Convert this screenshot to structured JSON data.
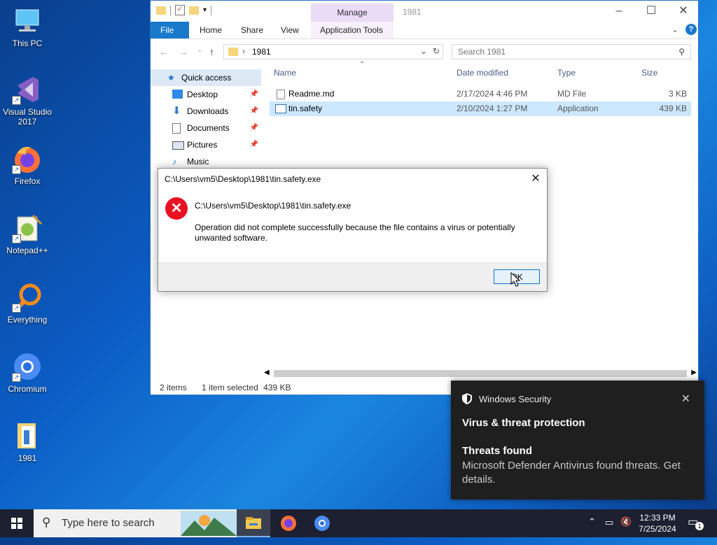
{
  "desktop": {
    "icons": [
      {
        "label": "This PC"
      },
      {
        "label": "Visual Studio 2017"
      },
      {
        "label": "Firefox"
      },
      {
        "label": "Notepad++"
      },
      {
        "label": "Everything"
      },
      {
        "label": "Chromium"
      },
      {
        "label": "1981"
      }
    ]
  },
  "explorer": {
    "title": "1981",
    "manage_label": "Manage",
    "ribbon_tabs": [
      "File",
      "Home",
      "Share",
      "View",
      "Application Tools"
    ],
    "address": "1981",
    "search_placeholder": "Search 1981",
    "nav": {
      "quick_access": "Quick access",
      "items": [
        {
          "label": "Desktop"
        },
        {
          "label": "Downloads"
        },
        {
          "label": "Documents"
        },
        {
          "label": "Pictures"
        },
        {
          "label": "Music"
        }
      ]
    },
    "columns": [
      "Name",
      "Date modified",
      "Type",
      "Size"
    ],
    "files": [
      {
        "name": "Readme.md",
        "date": "2/17/2024 4:46 PM",
        "type": "MD File",
        "size": "3 KB"
      },
      {
        "name": "tin.safety",
        "date": "2/10/2024 1:27 PM",
        "type": "Application",
        "size": "439 KB"
      }
    ],
    "status": {
      "count": "2 items",
      "selected": "1 item selected",
      "size": "439 KB"
    }
  },
  "dialog": {
    "title": "C:\\Users\\vm5\\Desktop\\1981\\tin.safety.exe",
    "heading": "C:\\Users\\vm5\\Desktop\\1981\\tin.safety.exe",
    "message": "Operation did not complete successfully because the file contains a virus or potentially unwanted software.",
    "ok_label": "OK"
  },
  "toast": {
    "app": "Windows Security",
    "heading": "Virus & threat protection",
    "subheading": "Threats found",
    "body": "Microsoft Defender Antivirus found threats. Get details."
  },
  "taskbar": {
    "search_placeholder": "Type here to search",
    "time": "12:33 PM",
    "date": "7/25/2024",
    "notification_count": "1"
  },
  "colors": {
    "accent": "#1979ca",
    "error": "#e81123",
    "toast_bg": "#1f1f1f",
    "taskbar": "#1c2030"
  }
}
